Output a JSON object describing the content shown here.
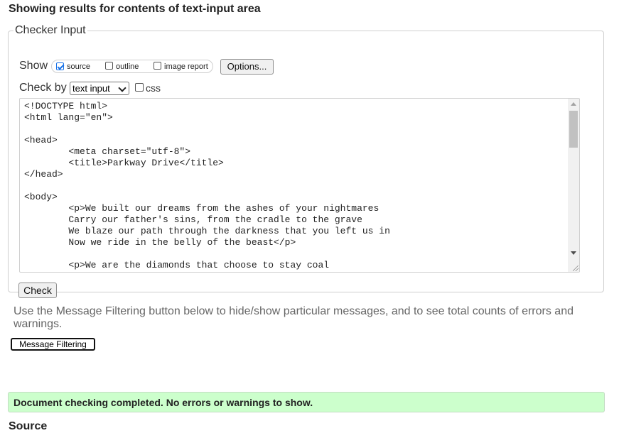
{
  "page": {
    "heading": "Showing results for contents of text-input area",
    "source_heading": "Source"
  },
  "checker": {
    "legend": "Checker Input",
    "show_label": "Show",
    "options": [
      {
        "label": "source",
        "checked": true
      },
      {
        "label": "outline",
        "checked": false
      },
      {
        "label": "image report",
        "checked": false
      }
    ],
    "options_button": "Options...",
    "check_by_label": "Check by",
    "check_by_value": "text input",
    "css_label": "css",
    "css_checked": false,
    "textarea_content": "<!DOCTYPE html>\n<html lang=\"en\">\n\n<head>\n        <meta charset=\"utf-8\">\n        <title>Parkway Drive</title>\n</head>\n\n<body>\n        <p>We built our dreams from the ashes of your nightmares\n        Carry our father's sins, from the cradle to the grave\n        We blaze our path through the darkness that you left us in\n        Now we ride in the belly of the beast</p>\n\n        <p>We are the diamonds that choose to stay coal",
    "check_button": "Check"
  },
  "filtering": {
    "info": "Use the Message Filtering button below to hide/show particular messages, and to see total counts of errors and warnings.",
    "button": "Message Filtering"
  },
  "result": {
    "message": "Document checking completed. No errors or warnings to show.",
    "color": "#ccffcc"
  }
}
